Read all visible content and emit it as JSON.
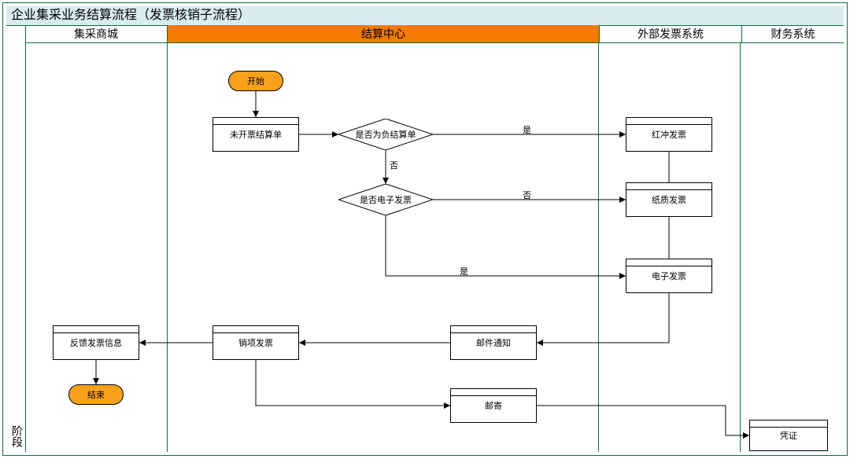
{
  "title": "企业集采业务结算流程（发票核销子流程）",
  "side_label": "阶段",
  "lanes": {
    "mall": "集采商城",
    "center": "结算中心",
    "ext": "外部发票系统",
    "fin": "财务系统"
  },
  "nodes": {
    "start": "开始",
    "end": "结束",
    "unbilled": "未开票结算单",
    "d_negative": "是否为负结算单",
    "d_einvoice": "是否电子发票",
    "red": "红冲发票",
    "paper": "纸质发票",
    "elec": "电子发票",
    "mail_notify": "邮件通知",
    "post": "邮寄",
    "sales_invoice": "销项发票",
    "feedback": "反馈发票信息",
    "voucher": "凭证"
  },
  "labels": {
    "yes": "是",
    "no": "否"
  }
}
